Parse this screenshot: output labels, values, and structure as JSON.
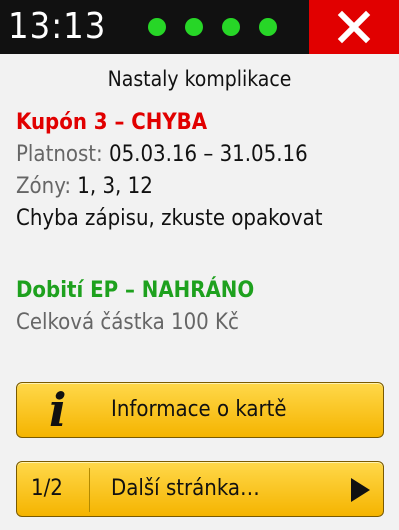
{
  "status": {
    "time": "13:13",
    "dots_color": "#27d627",
    "close_color": "#e10000"
  },
  "title": "Nastaly komplikace",
  "coupon": {
    "heading": "Kupón 3 – CHYBA",
    "validity_label": "Platnost:",
    "validity_value": " 05.03.16 – 31.05.16",
    "zones_label": "Zóny:",
    "zones_value": " 1, 3, 12",
    "error_message": "Chyba zápisu, zkuste opakovat"
  },
  "topup": {
    "heading": "Dobití EP – NAHRÁNO",
    "amount": "Celková částka 100 Kč"
  },
  "buttons": {
    "info_label": "Informace o kartě",
    "page_indicator": "1/2",
    "next_label": "Další stránka…"
  }
}
